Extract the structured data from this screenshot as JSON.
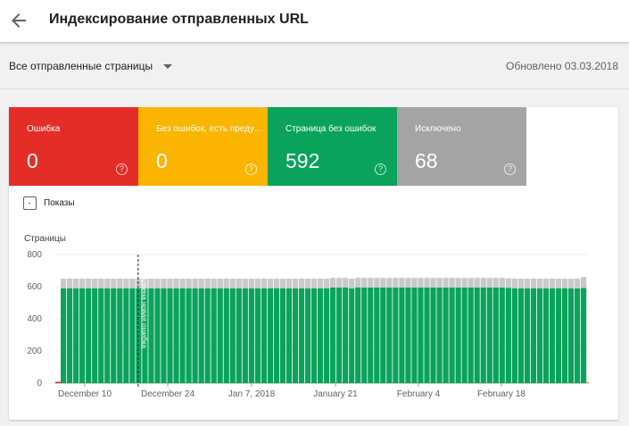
{
  "header": {
    "title": "Индексирование отправленных URL",
    "back_icon": "arrow-back-icon"
  },
  "filter": {
    "selected": "Все отправленные страницы",
    "updated": "Обновлено 03.03.2018"
  },
  "tiles": [
    {
      "label": "Ошибка",
      "value": "0",
      "color": "#e52d27"
    },
    {
      "label": "Без ошибок, есть предупреждения",
      "value": "0",
      "color": "#fbb400"
    },
    {
      "label": "Страница без ошибок",
      "value": "592",
      "color": "#0aa35b"
    },
    {
      "label": "Исключено",
      "value": "68",
      "color": "#a4a4a4"
    }
  ],
  "impressions": {
    "label": "Показы",
    "checked": false
  },
  "chart_data": {
    "type": "bar",
    "stacked": true,
    "ylabel": "Страницы",
    "ylim": [
      0,
      800
    ],
    "yticks": [
      0,
      200,
      400,
      600,
      800
    ],
    "xticks": [
      "December 10",
      "December 24",
      "Jan 7, 2018",
      "January 21",
      "February 4",
      "February 18"
    ],
    "bar_count": 84,
    "series": [
      {
        "color": "#e52d27",
        "values": [
          0
        ]
      },
      {
        "color": "#fbb400",
        "values": [
          0
        ]
      },
      {
        "color": "#0aa35b",
        "values": [
          590,
          590,
          590,
          590,
          590,
          590,
          590,
          590,
          590,
          590,
          590,
          590,
          590,
          590,
          590,
          590,
          590,
          590,
          590,
          590,
          590,
          590,
          590,
          590,
          590,
          590,
          590,
          590,
          590,
          590,
          590,
          590,
          590,
          590,
          590,
          590,
          590,
          590,
          590,
          590,
          590,
          590,
          590,
          595,
          595,
          595,
          590,
          595,
          595,
          595,
          595,
          595,
          595,
          595,
          595,
          595,
          595,
          595,
          595,
          595,
          595,
          595,
          595,
          595,
          595,
          595,
          595,
          595,
          595,
          595,
          595,
          592,
          590,
          590,
          590,
          590,
          590,
          590,
          590,
          590,
          590,
          590,
          590,
          592
        ]
      },
      {
        "color": "#c9c9c9",
        "values": [
          60,
          60,
          60,
          60,
          60,
          60,
          60,
          60,
          60,
          60,
          60,
          60,
          60,
          60,
          60,
          60,
          60,
          60,
          60,
          60,
          60,
          60,
          60,
          60,
          60,
          60,
          60,
          60,
          60,
          60,
          60,
          60,
          60,
          60,
          60,
          60,
          60,
          60,
          60,
          60,
          60,
          60,
          60,
          60,
          60,
          60,
          60,
          60,
          60,
          60,
          60,
          60,
          60,
          60,
          60,
          60,
          60,
          60,
          60,
          60,
          60,
          60,
          60,
          60,
          60,
          60,
          60,
          60,
          60,
          60,
          60,
          60,
          60,
          60,
          60,
          60,
          60,
          60,
          60,
          60,
          60,
          60,
          60,
          68
        ]
      }
    ],
    "annotation": {
      "text": "Обнаружена новая ошибка",
      "bar_index": 13
    }
  }
}
